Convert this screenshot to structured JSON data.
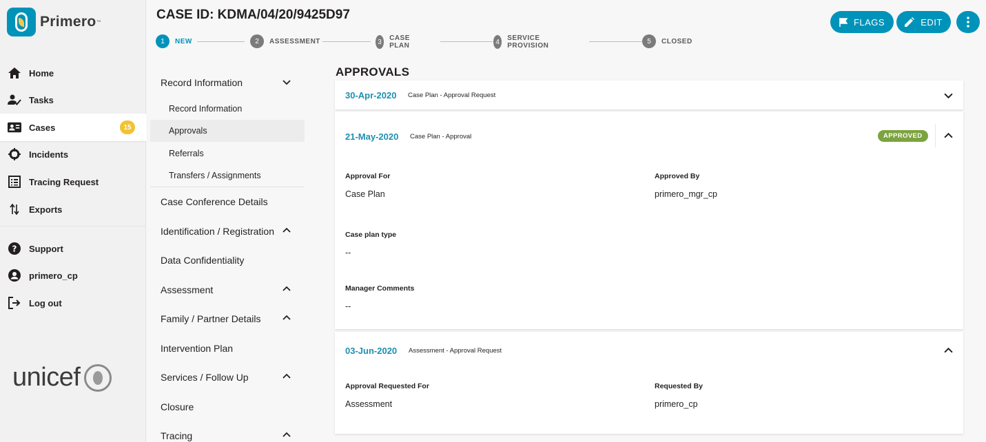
{
  "app": {
    "name": "Primero",
    "tm": "™"
  },
  "nav": {
    "items": [
      {
        "label": "Home",
        "icon": "home-icon"
      },
      {
        "label": "Tasks",
        "icon": "tasks-icon"
      },
      {
        "label": "Cases",
        "icon": "cases-icon",
        "badge": "15"
      },
      {
        "label": "Incidents",
        "icon": "incidents-icon"
      },
      {
        "label": "Tracing Request",
        "icon": "tracing-request-icon"
      },
      {
        "label": "Exports",
        "icon": "exports-icon"
      }
    ],
    "secondary": [
      {
        "label": "Support",
        "icon": "support-icon"
      },
      {
        "label": "primero_cp",
        "icon": "user-icon"
      },
      {
        "label": "Log out",
        "icon": "logout-icon"
      }
    ],
    "partner_logo_text": "unicef"
  },
  "header": {
    "title": "CASE ID: KDMA/04/20/9425D97",
    "buttons": {
      "flags": "FLAGS",
      "edit": "EDIT"
    },
    "steps": [
      {
        "num": "1",
        "label": "NEW",
        "active": true
      },
      {
        "num": "2",
        "label": "ASSESSMENT"
      },
      {
        "num": "3",
        "label": "CASE PLAN"
      },
      {
        "num": "4",
        "label": "SERVICE PROVISION"
      },
      {
        "num": "5",
        "label": "CLOSED"
      }
    ]
  },
  "form_nav": {
    "record_information": "Record Information",
    "sub": [
      "Record Information",
      "Approvals",
      "Referrals",
      "Transfers / Assignments"
    ],
    "groups": [
      "Case Conference Details",
      "Identification / Registration",
      "Data Confidentiality",
      "Assessment",
      "Family / Partner Details",
      "Intervention Plan",
      "Services / Follow Up",
      "Closure",
      "Tracing"
    ]
  },
  "approvals": {
    "title": "APPROVALS",
    "items": [
      {
        "date": "30-Apr-2020",
        "desc": "Case Plan - Approval Request"
      },
      {
        "date": "21-May-2020",
        "desc": "Case Plan - Approval",
        "status": "APPROVED",
        "fields": {
          "approval_for_label": "Approval For",
          "approval_for": "Case Plan",
          "approved_by_label": "Approved By",
          "approved_by": "primero_mgr_cp",
          "case_plan_type_label": "Case plan type",
          "case_plan_type": "--",
          "manager_comments_label": "Manager Comments",
          "manager_comments": "--"
        }
      },
      {
        "date": "03-Jun-2020",
        "desc": "Assessment - Approval Request",
        "fields": {
          "requested_for_label": "Approval Requested For",
          "requested_for": "Assessment",
          "requested_by_label": "Requested By",
          "requested_by": "primero_cp"
        }
      }
    ]
  },
  "colors": {
    "primary": "#0093ba",
    "approved": "#7ca33f",
    "badge": "#f2c230"
  }
}
